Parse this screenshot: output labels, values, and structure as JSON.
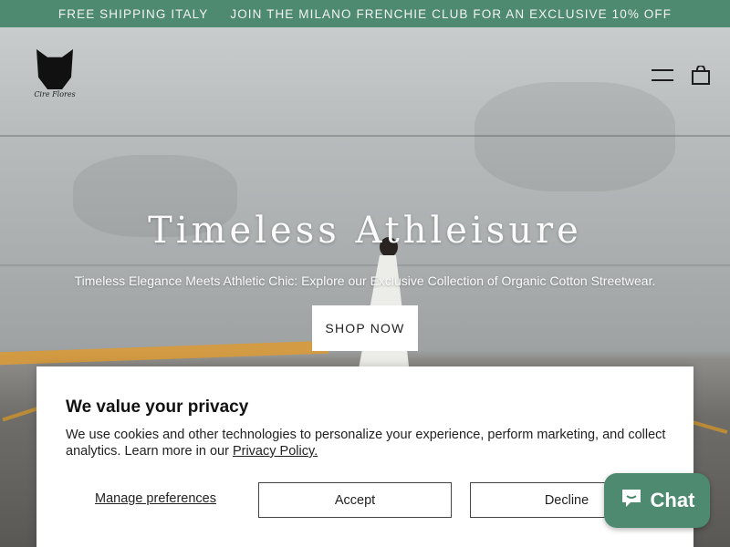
{
  "announcement": {
    "left": "FREE SHIPPING ITALY",
    "right": "JOIN THE MILANO FRENCHIE CLUB FOR AN EXCLUSIVE 10% OFF"
  },
  "brand": {
    "logo_script": "Cire Flores"
  },
  "header": {
    "menu_icon": "hamburger-menu-icon",
    "cart_icon": "shopping-bag-icon"
  },
  "hero": {
    "title": "Timeless Athleisure",
    "subtitle": "Timeless Elegance Meets Athletic Chic: Explore our Exclusive Collection of Organic Cotton Streetwear.",
    "cta": "SHOP NOW"
  },
  "privacy": {
    "title": "We value your privacy",
    "body": "We use cookies and other technologies to personalize your experience, perform marketing, and collect analytics. Learn more in our ",
    "policy_link": "Privacy Policy.",
    "manage": "Manage preferences",
    "accept": "Accept",
    "decline": "Decline"
  },
  "chat": {
    "label": "Chat",
    "icon": "chat-bubble-icon"
  },
  "colors": {
    "accent": "#4e8a70",
    "cta_bg": "#ffffff"
  }
}
